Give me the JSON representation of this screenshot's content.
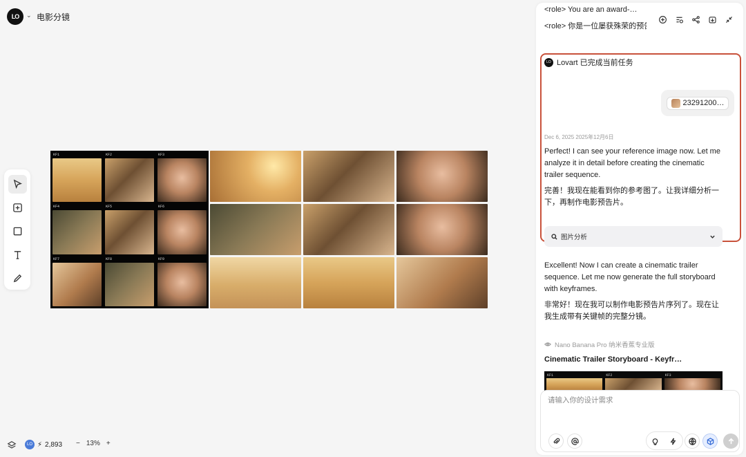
{
  "header": {
    "logo_text": "LO",
    "project_title": "电影分镜"
  },
  "toolbar": {
    "tools": [
      {
        "name": "select",
        "icon": "cursor-icon",
        "active": true
      },
      {
        "name": "add",
        "icon": "plus-square-icon"
      },
      {
        "name": "shape",
        "icon": "square-icon"
      },
      {
        "name": "text",
        "icon": "text-icon"
      },
      {
        "name": "pen",
        "icon": "pen-icon"
      }
    ]
  },
  "canvas": {
    "keyframe_sheet": {
      "labels": [
        "KF1",
        "KF2",
        "KF3",
        "KF4",
        "KF5",
        "KF6",
        "KF7",
        "KF8",
        "KF9"
      ]
    }
  },
  "status": {
    "credits": "2,893",
    "zoom": "13%",
    "zoom_out": "−",
    "zoom_in": "+"
  },
  "chat": {
    "role_lines": [
      "<role> You are an award-…",
      "<role> 你是一位屡获殊荣的预告"
    ],
    "assistant_name": "Lovart 已完成当前任务",
    "attachment_name": "23291200…",
    "timestamp": "Dec 6, 2025  2025年12月6日",
    "message1_en": "Perfect! I can see your reference image now. Let me analyze it in detail before creating the cinematic trailer sequence.",
    "message1_zh": "完善！我现在能看到你的参考图了。让我详细分析一下，再制作电影预告片。",
    "collapse_label": "图片分析",
    "message2_en": "Excellent! Now I can create a cinematic trailer sequence. Let me now generate the full storyboard with keyframes.",
    "message2_zh": "非常好！现在我可以制作电影预告片序列了。现在让我生成带有关键帧的完整分镜。",
    "tool_used": "Nano Banana Pro  纳米香蕉专业版",
    "result_title": "Cinematic Trailer Storyboard - Keyfr…",
    "preview_labels": [
      "KF1",
      "KF2",
      "KF3"
    ],
    "composer_placeholder": "请输入你的设计需求"
  },
  "colors": {
    "highlight": "#c8513a",
    "accent": "#3a6fd8"
  }
}
